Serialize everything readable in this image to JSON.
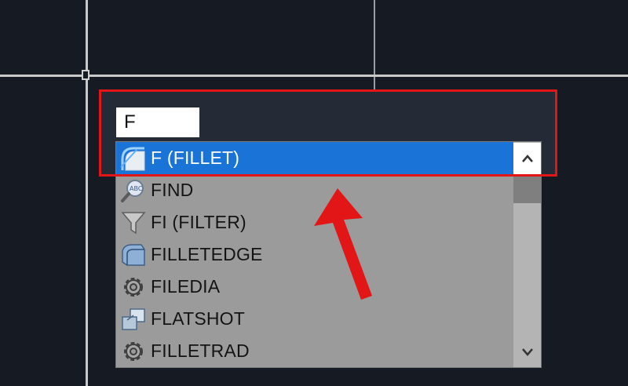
{
  "command_input": {
    "value": "F"
  },
  "suggestions": [
    {
      "label": "F (FILLET)",
      "icon": "fillet-icon",
      "selected": true
    },
    {
      "label": "FIND",
      "icon": "find-text-icon",
      "selected": false
    },
    {
      "label": "FI (FILTER)",
      "icon": "filter-funnel-icon",
      "selected": false
    },
    {
      "label": "FILLETEDGE",
      "icon": "filletedge-icon",
      "selected": false
    },
    {
      "label": "FILEDIA",
      "icon": "gear-icon",
      "selected": false
    },
    {
      "label": "FLATSHOT",
      "icon": "flatshot-icon",
      "selected": false
    },
    {
      "label": "FILLETRAD",
      "icon": "gear-icon",
      "selected": false
    }
  ],
  "scrollbar": {
    "up_icon": "chevron-up-icon",
    "down_icon": "chevron-down-icon"
  },
  "colors": {
    "canvas": "#161a22",
    "selection": "#1a73d6",
    "list_bg": "#9b9b9b",
    "highlight": "#e21616"
  }
}
